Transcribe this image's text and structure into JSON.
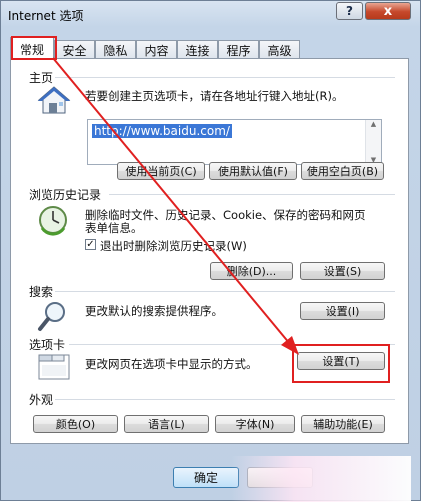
{
  "window": {
    "title": "Internet 选项",
    "help": "?",
    "close": "x"
  },
  "tabs": [
    "常规",
    "安全",
    "隐私",
    "内容",
    "连接",
    "程序",
    "高级"
  ],
  "home": {
    "title": "主页",
    "desc": "若要创建主页选项卡，请在各地址行键入地址(R)。",
    "url": "http://www.baidu.com/",
    "buttons": [
      "使用当前页(C)",
      "使用默认值(F)",
      "使用空白页(B)"
    ]
  },
  "history": {
    "title": "浏览历史记录",
    "desc1": "删除临时文件、历史记录、Cookie、保存的密码和网页",
    "desc2": "表单信息。",
    "checkbox_label": "退出时删除浏览历史记录(W)",
    "checkbox_mark": "✓",
    "delete_btn": "删除(D)...",
    "settings_btn": "设置(S)"
  },
  "search": {
    "title": "搜索",
    "desc": "更改默认的搜索提供程序。",
    "settings_btn": "设置(I)"
  },
  "tabs_section": {
    "title": "选项卡",
    "desc": "更改网页在选项卡中显示的方式。",
    "settings_btn": "设置(T)"
  },
  "appearance": {
    "title": "外观",
    "buttons": [
      "颜色(O)",
      "语言(L)",
      "字体(N)",
      "辅助功能(E)"
    ]
  },
  "footer": {
    "ok": "确定"
  },
  "colors": {
    "annotation": "#e02020"
  }
}
